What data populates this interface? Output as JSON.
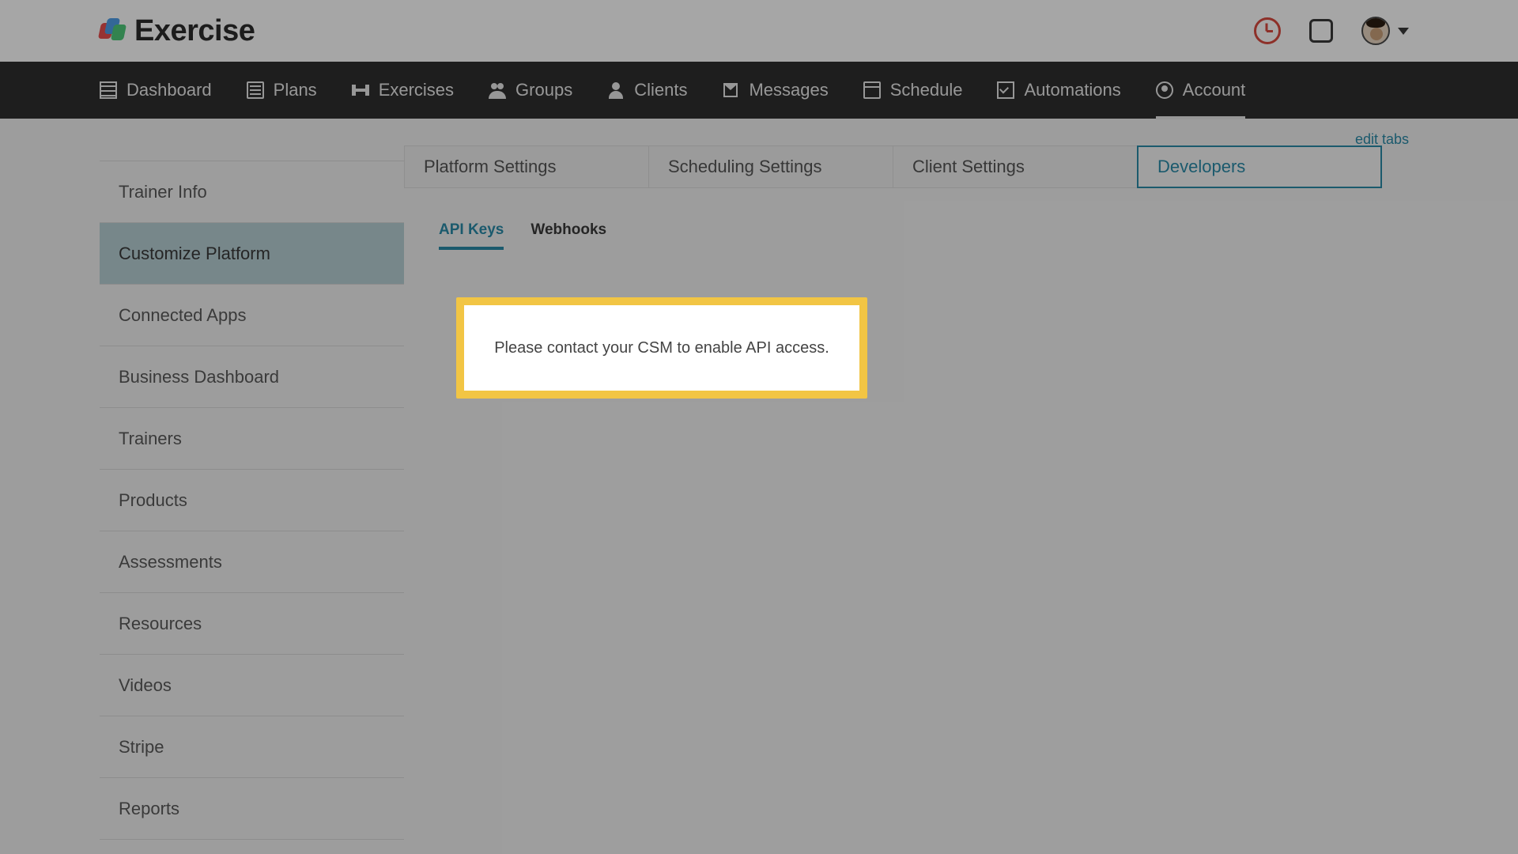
{
  "brand": {
    "name": "Exercise"
  },
  "header_icons": {
    "clock": "clock-icon",
    "square": "square-icon",
    "avatar": "avatar",
    "caret": "caret-down-icon"
  },
  "nav": [
    {
      "label": "Dashboard",
      "icon": "dashboard-icon",
      "active": false
    },
    {
      "label": "Plans",
      "icon": "plans-icon",
      "active": false
    },
    {
      "label": "Exercises",
      "icon": "exercises-icon",
      "active": false
    },
    {
      "label": "Groups",
      "icon": "groups-icon",
      "active": false
    },
    {
      "label": "Clients",
      "icon": "clients-icon",
      "active": false
    },
    {
      "label": "Messages",
      "icon": "messages-icon",
      "active": false
    },
    {
      "label": "Schedule",
      "icon": "schedule-icon",
      "active": false
    },
    {
      "label": "Automations",
      "icon": "automations-icon",
      "active": false
    },
    {
      "label": "Account",
      "icon": "account-icon",
      "active": true
    }
  ],
  "sidebar": {
    "items": [
      {
        "label": "Trainer Info"
      },
      {
        "label": "Customize Platform",
        "active": true
      },
      {
        "label": "Connected Apps"
      },
      {
        "label": "Business Dashboard"
      },
      {
        "label": "Trainers"
      },
      {
        "label": "Products"
      },
      {
        "label": "Assessments"
      },
      {
        "label": "Resources"
      },
      {
        "label": "Videos"
      },
      {
        "label": "Stripe"
      },
      {
        "label": "Reports"
      }
    ]
  },
  "edit_tabs_label": "edit tabs",
  "tabs": [
    {
      "label": "Platform Settings"
    },
    {
      "label": "Scheduling Settings"
    },
    {
      "label": "Client Settings"
    },
    {
      "label": "Developers",
      "active": true
    }
  ],
  "subtabs": [
    {
      "label": "API Keys",
      "active": true
    },
    {
      "label": "Webhooks"
    }
  ],
  "card": {
    "message": "Please contact your CSM to enable API access."
  },
  "colors": {
    "accent_teal": "#2a8aa8",
    "highlight_yellow": "#f2c544",
    "alert_red": "#d94a3f",
    "navbar_bg": "#2f2f2f"
  }
}
